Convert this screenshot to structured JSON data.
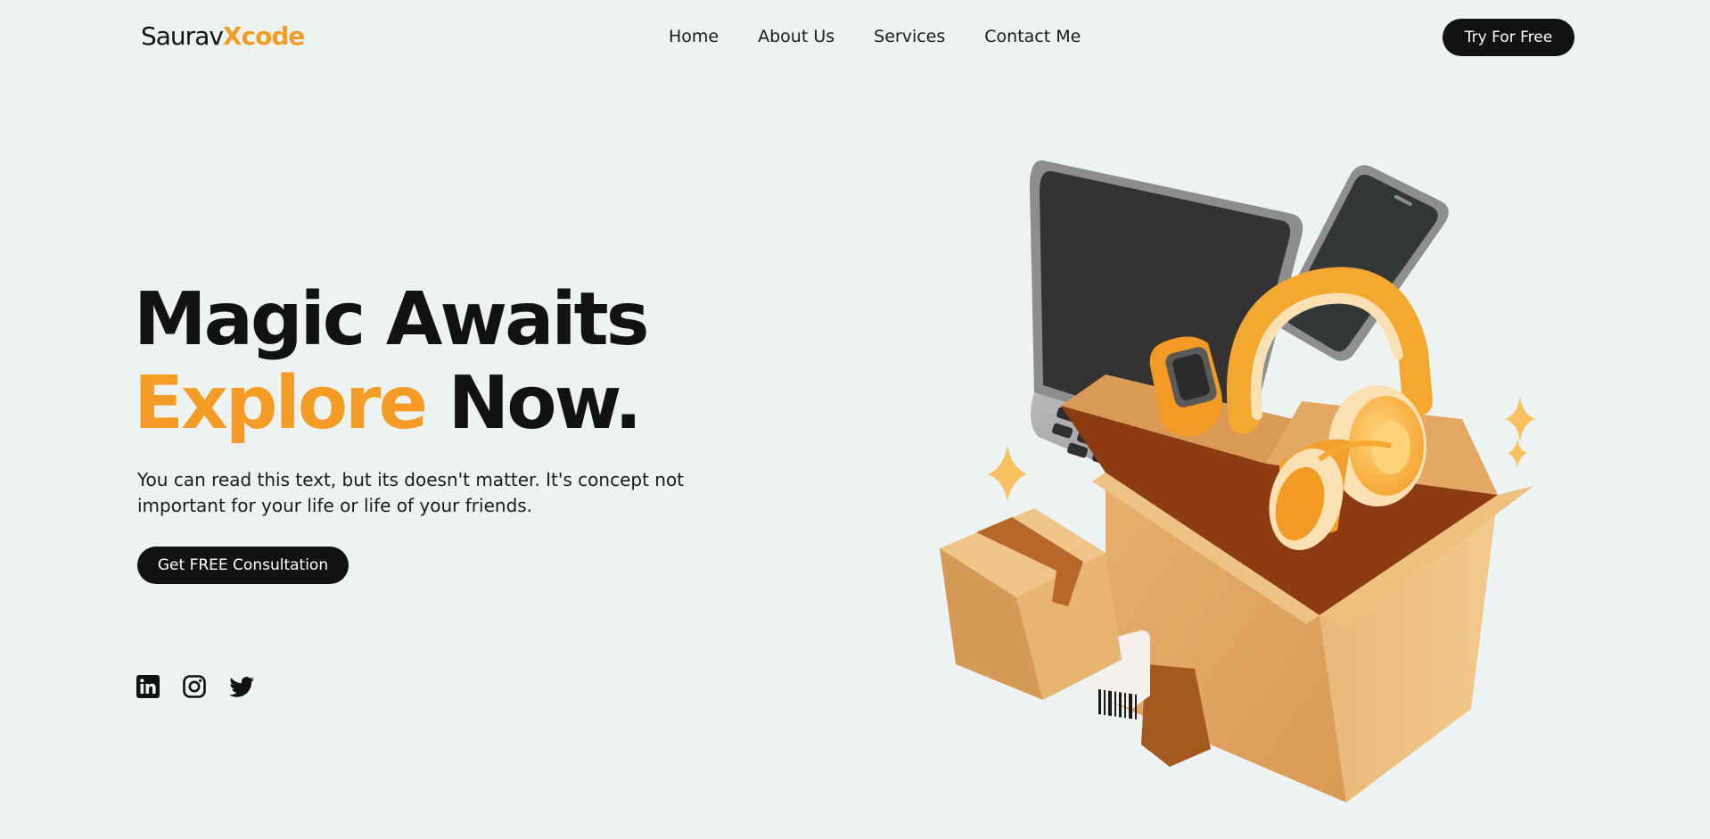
{
  "brand": {
    "logo_first": "Saurav",
    "logo_second": "Xcode"
  },
  "nav": {
    "items": [
      "Home",
      "About Us",
      "Services",
      "Contact Me"
    ]
  },
  "header": {
    "cta_label": "Try For Free"
  },
  "hero": {
    "headline_line1": "Magic Awaits",
    "headline_accent": "Explore",
    "headline_rest": "Now.",
    "description": "You can read this text, but its doesn't matter. It's concept not important for your life or life of your friends.",
    "cta_label": "Get FREE Consultation"
  },
  "socials": [
    "linkedin-icon",
    "instagram-icon",
    "twitter-icon"
  ],
  "colors": {
    "accent": "#f49c25",
    "dark": "#121212",
    "background": "#edf2f2"
  }
}
